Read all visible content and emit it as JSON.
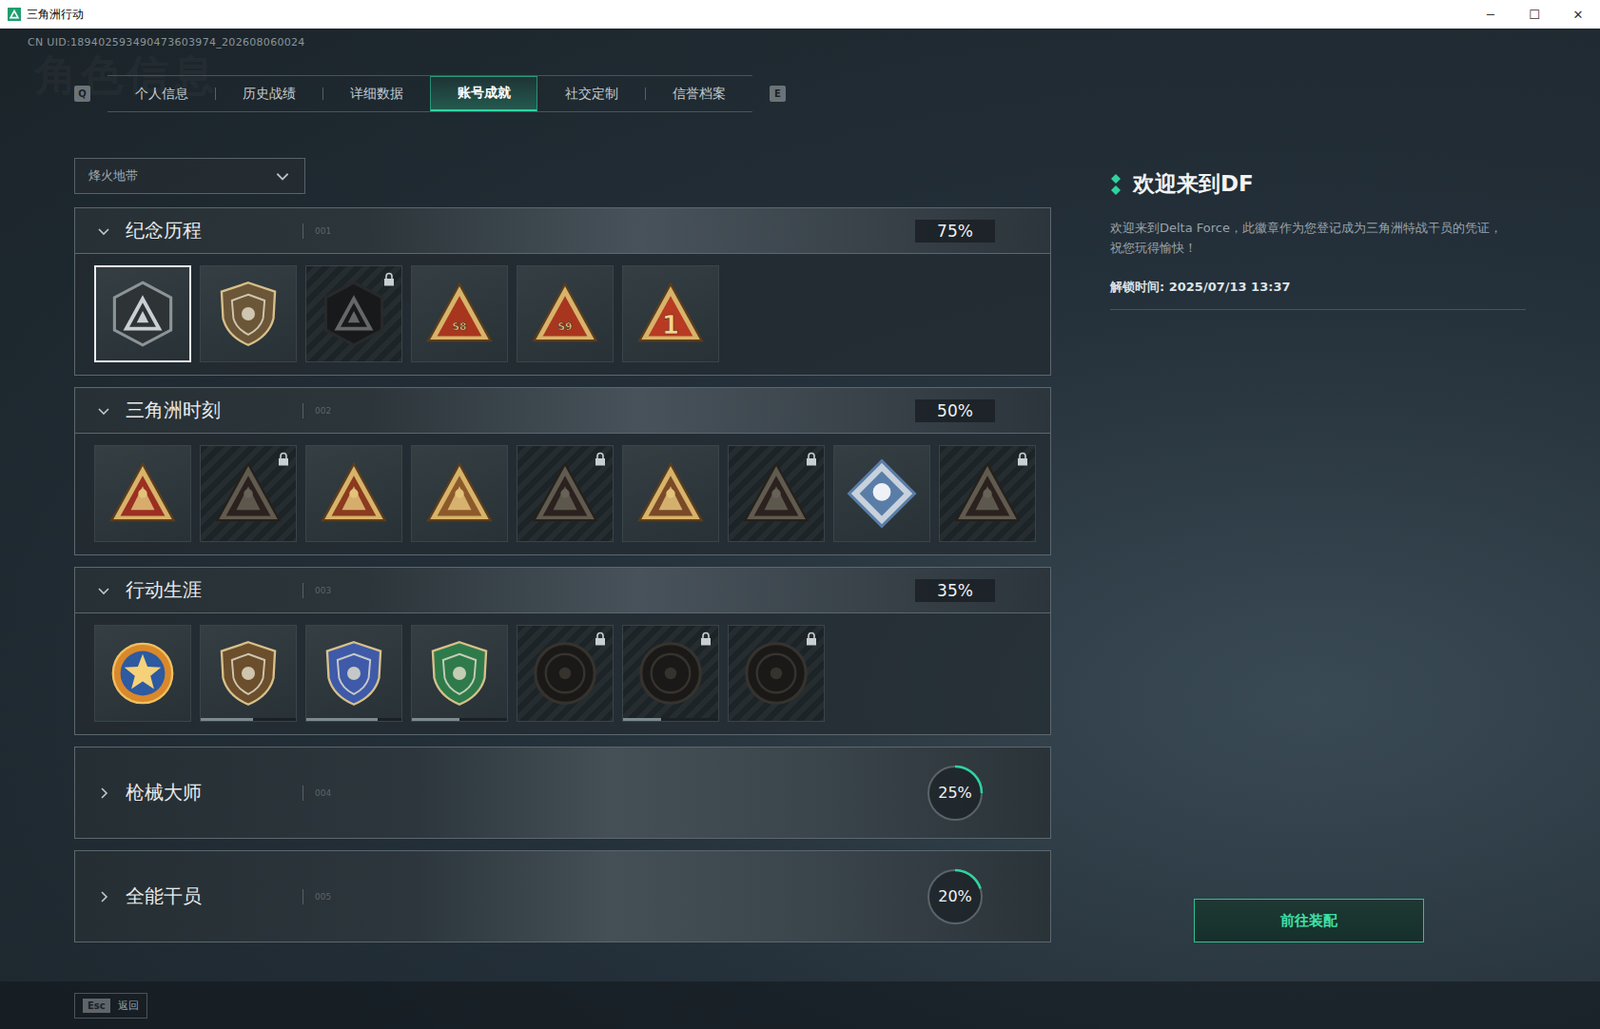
{
  "window": {
    "title": "三角洲行动",
    "controls": [
      "─",
      "☐",
      "✕"
    ]
  },
  "uid": "CN UID:189402593490473603974_202608060024",
  "watermark": "角色信息",
  "tabs": {
    "prev_key": "Q",
    "next_key": "E",
    "items": [
      {
        "label": "个人信息",
        "selected": false
      },
      {
        "label": "历史战绩",
        "selected": false
      },
      {
        "label": "详细数据",
        "selected": false
      },
      {
        "label": "账号成就",
        "selected": true
      },
      {
        "label": "社交定制",
        "selected": false
      },
      {
        "label": "信誉档案",
        "selected": false
      }
    ]
  },
  "mode_select": {
    "value": "烽火地带"
  },
  "sections": [
    {
      "title": "纪念历程",
      "index": "001",
      "percent": "75%",
      "expanded": true,
      "badges": [
        {
          "kind": "hex",
          "color": "#8b9499",
          "locked": false,
          "selected": true
        },
        {
          "kind": "shield",
          "color": "#6b5638",
          "locked": false,
          "selected": false
        },
        {
          "kind": "hex",
          "color": "#4a5357",
          "locked": true,
          "selected": false
        },
        {
          "kind": "tri",
          "color": "#a8361f",
          "locked": false,
          "selected": false,
          "mark": "S8"
        },
        {
          "kind": "tri",
          "color": "#a8361f",
          "locked": false,
          "selected": false,
          "mark": "S9"
        },
        {
          "kind": "tri",
          "color": "#b83a22",
          "locked": false,
          "selected": false,
          "mark": "1"
        }
      ]
    },
    {
      "title": "三角洲时刻",
      "index": "002",
      "percent": "50%",
      "expanded": true,
      "badges": [
        {
          "kind": "tri",
          "color": "#9b2f22",
          "locked": false,
          "selected": false
        },
        {
          "kind": "tri",
          "color": "#7a3a22",
          "locked": true,
          "selected": false
        },
        {
          "kind": "tri",
          "color": "#8a3a1e",
          "locked": false,
          "selected": false
        },
        {
          "kind": "tri",
          "color": "#8c5a2a",
          "locked": false,
          "selected": false
        },
        {
          "kind": "tri",
          "color": "#7a3a22",
          "locked": true,
          "selected": false
        },
        {
          "kind": "tri",
          "color": "#7a4a28",
          "locked": false,
          "selected": false
        },
        {
          "kind": "tri",
          "color": "#7a3a22",
          "locked": true,
          "selected": false
        },
        {
          "kind": "diamond",
          "color": "#5a7da8",
          "locked": false,
          "selected": false
        },
        {
          "kind": "tri",
          "color": "#7a3a22",
          "locked": true,
          "selected": false
        }
      ]
    },
    {
      "title": "行动生涯",
      "index": "003",
      "percent": "35%",
      "expanded": true,
      "badges": [
        {
          "kind": "star",
          "color": "#d9882a",
          "locked": false,
          "selected": false
        },
        {
          "kind": "shield",
          "color": "#6b4e2c",
          "locked": false,
          "selected": false,
          "level": 0.55
        },
        {
          "kind": "shield",
          "color": "#3e5aa8",
          "locked": false,
          "selected": false,
          "level": 0.75
        },
        {
          "kind": "shield",
          "color": "#2f7a4a",
          "locked": false,
          "selected": false,
          "level": 0.5
        },
        {
          "kind": "round",
          "color": "#7a6446",
          "locked": true,
          "selected": false
        },
        {
          "kind": "round",
          "color": "#7a6446",
          "locked": true,
          "selected": false,
          "level": 0.4
        },
        {
          "kind": "round",
          "color": "#7a6446",
          "locked": true,
          "selected": false
        }
      ]
    },
    {
      "title": "枪械大师",
      "index": "004",
      "percent": "25%",
      "expanded": false,
      "level": 0.25
    },
    {
      "title": "全能干员",
      "index": "005",
      "percent": "20%",
      "expanded": false,
      "level": 0.2
    }
  ],
  "detail": {
    "title": "欢迎来到DF",
    "description": "欢迎来到Delta Force，此徽章作为您登记成为三角洲特战干员的凭证，祝您玩得愉快！",
    "unlock": "解锁时间: 2025/07/13 13:37",
    "action": "前往装配"
  },
  "footer": {
    "key": "Esc",
    "label": "返回"
  }
}
